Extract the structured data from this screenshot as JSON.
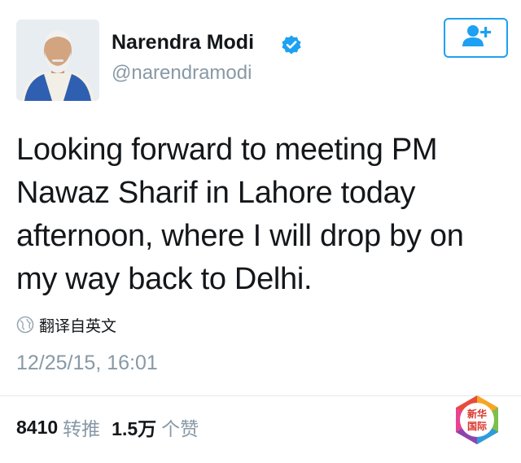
{
  "profile": {
    "display_name": "Narendra Modi",
    "handle": "@narendramodi",
    "verified": true
  },
  "tweet": {
    "text": "Looking forward to meeting PM Nawaz Sharif in Lahore today afternoon, where I will drop by on my way back to Delhi.",
    "translate_label": "翻译自英文",
    "timestamp": "12/25/15, 16:01"
  },
  "stats": {
    "retweets_count": "8410",
    "retweets_label": "转推",
    "likes_count": "1.5万",
    "likes_label": "个赞"
  },
  "watermark": {
    "line1": "新华",
    "line2": "国际"
  },
  "icons": {
    "follow": "follow-user-icon",
    "verified": "verified-badge-icon",
    "translate": "globe-icon"
  },
  "colors": {
    "accent": "#1da1f2",
    "secondary_text": "#8899a6",
    "primary_text": "#14171a"
  }
}
